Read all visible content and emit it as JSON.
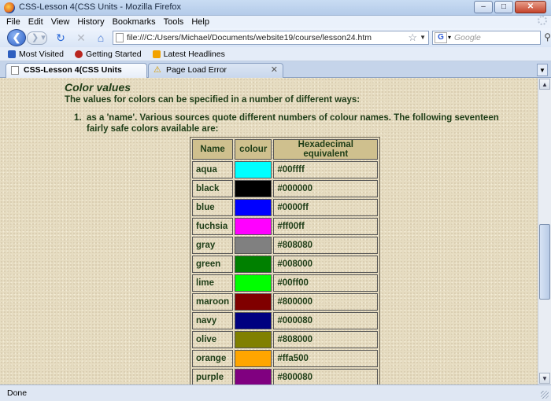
{
  "window": {
    "title": "CSS-Lesson 4(CSS Units - Mozilla Firefox",
    "min": "–",
    "max": "□",
    "close": "✕"
  },
  "menu": [
    "File",
    "Edit",
    "View",
    "History",
    "Bookmarks",
    "Tools",
    "Help"
  ],
  "nav": {
    "url": "file:///C:/Users/Michael/Documents/website19/course/lesson24.htm",
    "search_placeholder": "Google",
    "search_engine_letter": "G"
  },
  "bookmarks": [
    "Most Visited",
    "Getting Started",
    "Latest Headlines"
  ],
  "tabs": [
    {
      "label": "CSS-Lesson 4(CSS Units",
      "active": true
    },
    {
      "label": "Page Load Error",
      "active": false
    }
  ],
  "content": {
    "heading": "Color values",
    "intro": "The values for colors can be specified in a number of different ways:",
    "list_number": "1.",
    "list_text": "as a 'name'. Various sources quote different numbers of colour names. The following seventeen fairly safe colors available are:",
    "table_headers": [
      "Name",
      "colour",
      "Hexadecimal equivalent"
    ],
    "colors": [
      {
        "name": "aqua",
        "hex": "#00ffff",
        "swatch": "#00ffff"
      },
      {
        "name": "black",
        "hex": "#000000",
        "swatch": "#000000"
      },
      {
        "name": "blue",
        "hex": "#0000ff",
        "swatch": "#0000ff"
      },
      {
        "name": "fuchsia",
        "hex": "#ff00ff",
        "swatch": "#ff00ff"
      },
      {
        "name": "gray",
        "hex": "#808080",
        "swatch": "#808080"
      },
      {
        "name": "green",
        "hex": "#008000",
        "swatch": "#008000"
      },
      {
        "name": "lime",
        "hex": "#00ff00",
        "swatch": "#00ff00"
      },
      {
        "name": "maroon",
        "hex": "#800000",
        "swatch": "#800000"
      },
      {
        "name": "navy",
        "hex": "#000080",
        "swatch": "#000080"
      },
      {
        "name": "olive",
        "hex": "#808000",
        "swatch": "#808000"
      },
      {
        "name": "orange",
        "hex": "#ffa500",
        "swatch": "#ffa500"
      },
      {
        "name": "purple",
        "hex": "#800080",
        "swatch": "#800080"
      },
      {
        "name": "",
        "hex": "",
        "swatch": "#ff0000"
      }
    ]
  },
  "status": "Done"
}
